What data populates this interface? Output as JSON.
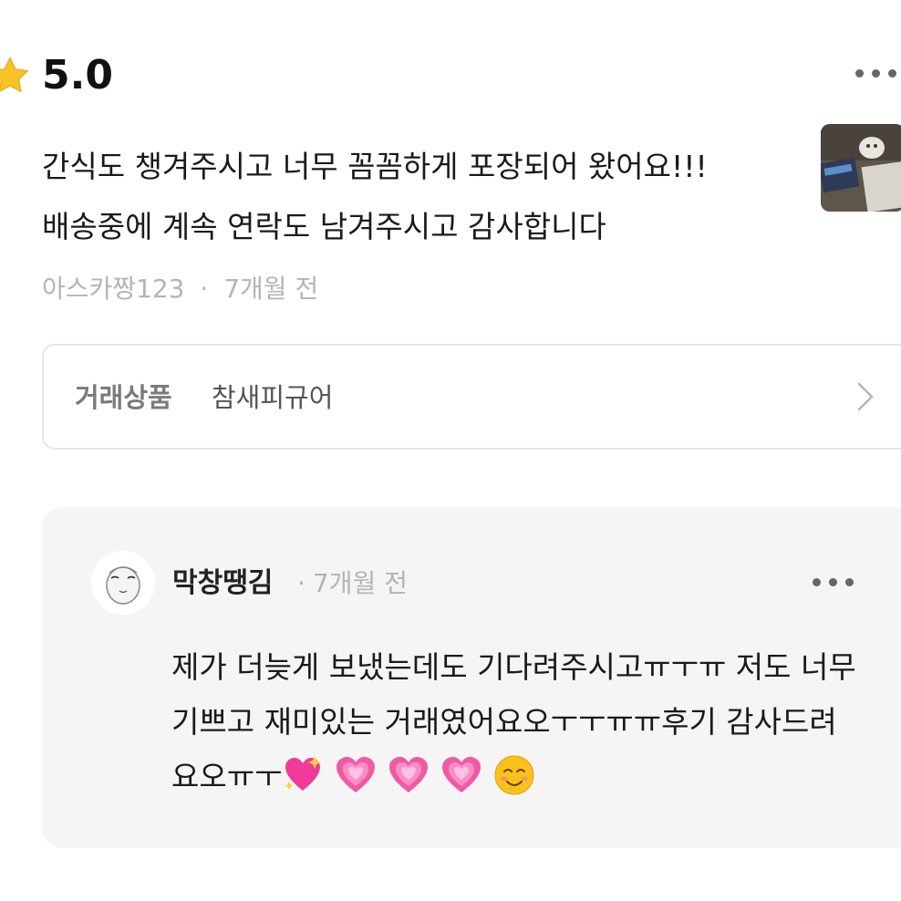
{
  "rating": {
    "value": "5.0",
    "icon": "star-icon",
    "color": "#f5c518"
  },
  "review": {
    "text": "간식도 챙겨주시고 너무 꼼꼼하게 포장되어 왔어요!!! 배송중에 계속 연락도 남겨주시고 감사합니다",
    "author": "아스카짱123",
    "separator": "·",
    "time": "7개월 전",
    "more_icon": "more-horizontal-icon"
  },
  "product": {
    "label": "거래상품",
    "name": "참새피규어",
    "icon": "chevron-right-icon"
  },
  "reply": {
    "author": "막창땡김",
    "separator": "·",
    "time": "7개월 전",
    "text": "제가 더늦게 보냈는데도 기다려주시고ㅠㅜㅠ 저도 너무 기쁘고 재미있는 거래였어요오ㅜㅜㅠㅠ후기 감사드려요오ㅠㅜ",
    "emojis": [
      "sparkling-heart-icon",
      "growing-heart-icon",
      "growing-heart-icon",
      "growing-heart-icon",
      "smiling-face-icon"
    ],
    "background": "#f5f5f5"
  }
}
